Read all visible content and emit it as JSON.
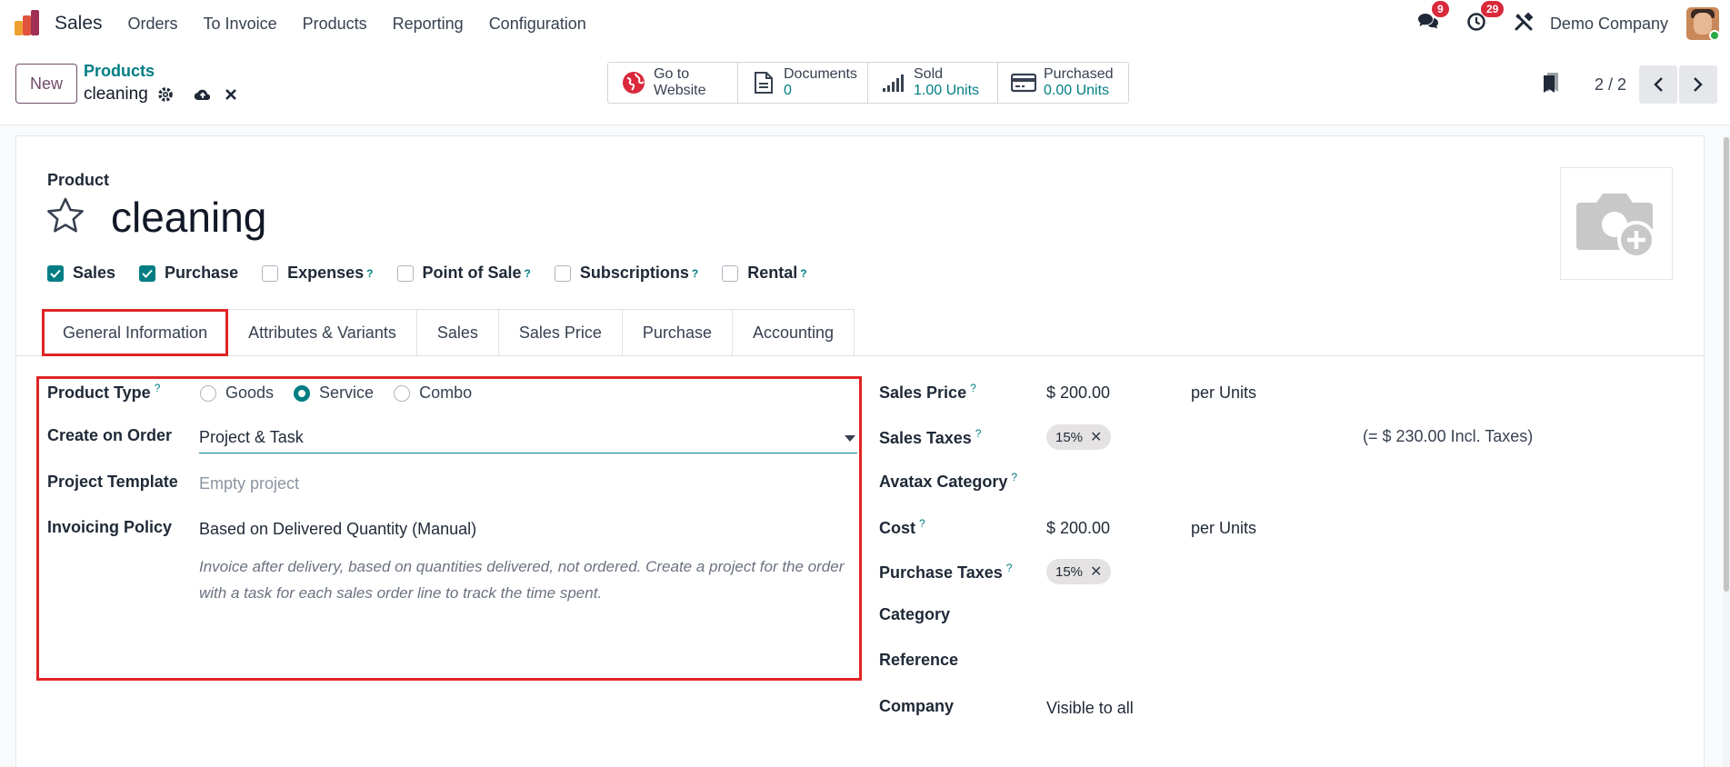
{
  "navbar": {
    "app_name": "Sales",
    "menu": [
      "Orders",
      "To Invoice",
      "Products",
      "Reporting",
      "Configuration"
    ],
    "messages_count": "9",
    "activities_count": "29",
    "company": "Demo Company"
  },
  "control": {
    "new_label": "New",
    "breadcrumb": "Products",
    "record_name": "cleaning",
    "smart_buttons": [
      {
        "line1": "Go to",
        "line2": "Website",
        "icon": "globe-icon"
      },
      {
        "line1": "Documents",
        "line2": "0",
        "icon": "document-icon"
      },
      {
        "line1": "Sold",
        "line2": "1.00 Units",
        "icon": "signal-bars-icon"
      },
      {
        "line1": "Purchased",
        "line2": "0.00 Units",
        "icon": "credit-card-icon"
      }
    ],
    "pager": "2 / 2"
  },
  "form": {
    "label_product": "Product",
    "title": "cleaning",
    "checkboxes": [
      {
        "label": "Sales",
        "checked": true,
        "help": ""
      },
      {
        "label": "Purchase",
        "checked": true,
        "help": ""
      },
      {
        "label": "Expenses",
        "checked": false,
        "help": "?"
      },
      {
        "label": "Point of Sale",
        "checked": false,
        "help": "?"
      },
      {
        "label": "Subscriptions",
        "checked": false,
        "help": "?"
      },
      {
        "label": "Rental",
        "checked": false,
        "help": "?"
      }
    ],
    "tabs": [
      "General Information",
      "Attributes & Variants",
      "Sales",
      "Sales Price",
      "Purchase",
      "Accounting"
    ],
    "left": {
      "product_type_label": "Product Type",
      "help_mark": "?",
      "product_type_options": [
        "Goods",
        "Service",
        "Combo"
      ],
      "product_type_selected": "Service",
      "create_on_order_label": "Create on Order",
      "create_on_order_value": "Project & Task",
      "project_template_label": "Project Template",
      "project_template_placeholder": "Empty project",
      "invoicing_policy_label": "Invoicing Policy",
      "invoicing_policy_value": "Based on Delivered Quantity (Manual)",
      "invoicing_help": "Invoice after delivery, based on quantities delivered, not ordered. Create a project for the order with a task for each sales order line to track the time spent."
    },
    "right": {
      "sales_price_label": "Sales Price",
      "sales_price_value": "$ 200.00",
      "sales_price_unit": "per Units",
      "sales_taxes_label": "Sales Taxes",
      "sales_taxes_tag": "15%",
      "sales_taxes_incl": "(= $ 230.00 Incl. Taxes)",
      "avatax_label": "Avatax Category",
      "cost_label": "Cost",
      "cost_value": "$ 200.00",
      "cost_unit": "per Units",
      "purchase_taxes_label": "Purchase Taxes",
      "purchase_taxes_tag": "15%",
      "category_label": "Category",
      "reference_label": "Reference",
      "company_label": "Company",
      "company_placeholder": "Visible to all"
    }
  }
}
